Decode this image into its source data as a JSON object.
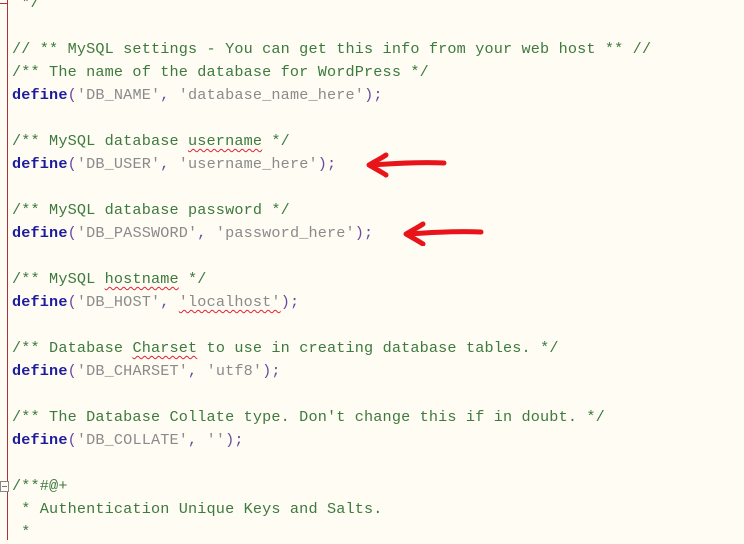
{
  "editor": {
    "language": "php",
    "file_section": "wp-config MySQL settings",
    "lines": [
      {
        "type": "comment",
        "text": " */"
      },
      {
        "type": "blank"
      },
      {
        "type": "comment",
        "text": "// ** MySQL settings - You can get this info from your web host ** //"
      },
      {
        "type": "comment",
        "text": "/** The name of the database for WordPress */"
      },
      {
        "type": "define",
        "keyword": "define",
        "name": "'DB_NAME'",
        "value": "'database_name_here'"
      },
      {
        "type": "blank"
      },
      {
        "type": "comment_parts",
        "parts": [
          {
            "text": "/** MySQL database "
          },
          {
            "text": "username",
            "squiggle": true
          },
          {
            "text": " */"
          }
        ]
      },
      {
        "type": "define",
        "keyword": "define",
        "name": "'DB_USER'",
        "value": "'username_here'",
        "annotation": "red-arrow"
      },
      {
        "type": "blank"
      },
      {
        "type": "comment",
        "text": "/** MySQL database password */"
      },
      {
        "type": "define",
        "keyword": "define",
        "name": "'DB_PASSWORD'",
        "value": "'password_here'",
        "annotation": "red-arrow"
      },
      {
        "type": "blank"
      },
      {
        "type": "comment_parts",
        "parts": [
          {
            "text": "/** MySQL "
          },
          {
            "text": "hostname",
            "squiggle": true
          },
          {
            "text": " */"
          }
        ]
      },
      {
        "type": "define",
        "keyword": "define",
        "name": "'DB_HOST'",
        "value": "'localhost'",
        "value_squiggle": true
      },
      {
        "type": "blank"
      },
      {
        "type": "comment_parts",
        "parts": [
          {
            "text": "/** Database "
          },
          {
            "text": "Charset",
            "squiggle": true
          },
          {
            "text": " to use in creating database tables. */"
          }
        ]
      },
      {
        "type": "define",
        "keyword": "define",
        "name": "'DB_CHARSET'",
        "value": "'utf8'"
      },
      {
        "type": "blank"
      },
      {
        "type": "comment",
        "text": "/** The Database Collate type. Don't change this if in doubt. */"
      },
      {
        "type": "define",
        "keyword": "define",
        "name": "'DB_COLLATE'",
        "value": "''"
      },
      {
        "type": "blank"
      },
      {
        "type": "comment",
        "text": "/**#@+",
        "fold": true
      },
      {
        "type": "comment",
        "text": " * Authentication Unique Keys and Salts."
      },
      {
        "type": "comment",
        "text": " *"
      }
    ]
  },
  "annotations": {
    "arrow_color": "#e8141a"
  },
  "colors": {
    "background": "#fffcf4",
    "comment": "#3d7a3d",
    "keyword": "#1c1c9c",
    "string": "#8a8a8a",
    "punctuation": "#6a4aa0",
    "margin_line": "#b0303a"
  }
}
